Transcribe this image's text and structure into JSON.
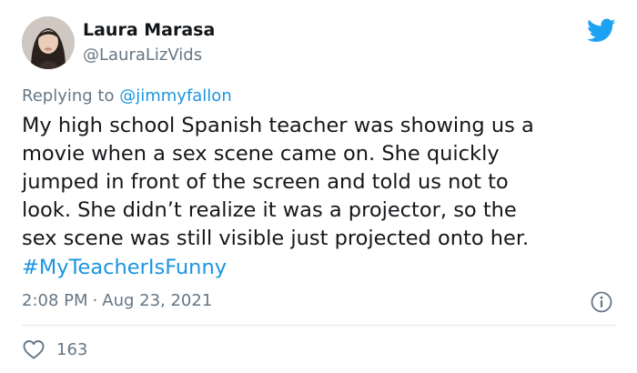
{
  "author": {
    "name": "Laura Marasa",
    "handle": "@LauraLizVids",
    "avatar_icon": "profile-photo"
  },
  "brand": {
    "icon": "twitter-bird-icon",
    "color": "#1da1f2"
  },
  "reply": {
    "prefix": "Replying to",
    "mention": "@jimmyfallon"
  },
  "tweet": {
    "text": "My high school Spanish teacher was showing us a\nmovie when a sex scene came on. She quickly\njumped in front of the screen and told us not to\nlook. She didn’t realize it was a projector, so the\nsex scene was still visible just projected onto her.",
    "hashtag": "#MyTeacherIsFunny",
    "time": "2:08 PM",
    "separator": "·",
    "date": "Aug 23, 2021"
  },
  "engagement": {
    "likes": "163",
    "like_icon": "heart-icon",
    "info_icon": "info-icon"
  },
  "colors": {
    "link": "#1b95e0",
    "secondary_text": "#657786",
    "divider": "#e1e8ed"
  }
}
